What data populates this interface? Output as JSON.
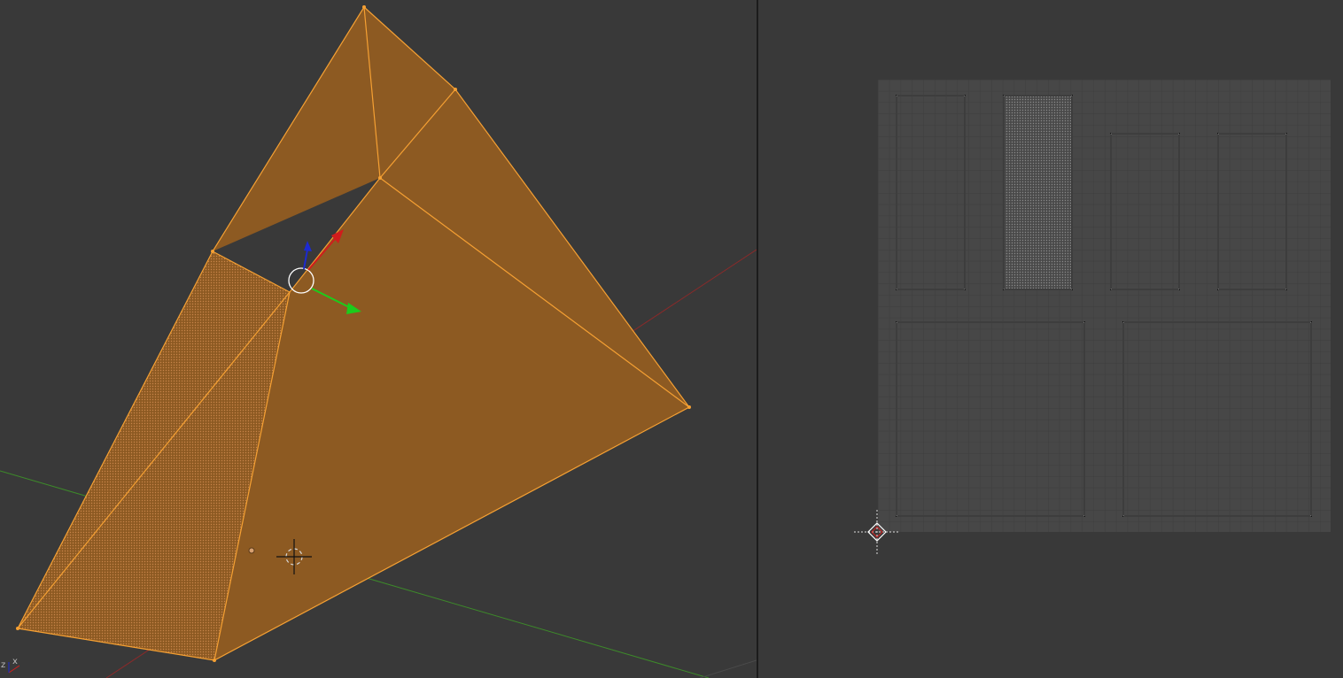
{
  "viewport_3d": {
    "axis_indicator": {
      "z_label": "z",
      "x_label": "x"
    },
    "colors": {
      "background": "#393939",
      "face_fill": "#8d5a22",
      "selected_edge": "#f5a033",
      "x_axis_line": "#8a2a2a",
      "y_axis_line": "#3d8a2a",
      "gizmo_x": "#d11c1c",
      "gizmo_y": "#1ccc1c",
      "gizmo_z": "#1c2ad1"
    }
  },
  "uv_editor": {
    "colors": {
      "grid_background": "#474747",
      "grid_line": "#3e3e3e",
      "island_edge": "#000000",
      "island_highlight": "#ffffff"
    }
  }
}
